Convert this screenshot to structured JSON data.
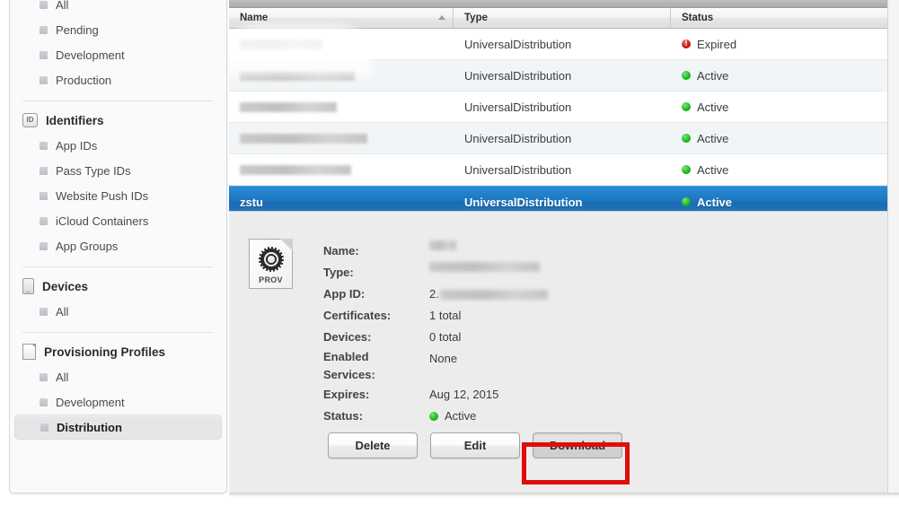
{
  "sidebar": {
    "groups": [
      {
        "name": "certificates-group",
        "header": null,
        "icon": null,
        "items": [
          {
            "label": "All",
            "selected": false
          },
          {
            "label": "Pending",
            "selected": false
          },
          {
            "label": "Development",
            "selected": false
          },
          {
            "label": "Production",
            "selected": false
          }
        ]
      },
      {
        "name": "identifiers-group",
        "header": "Identifiers",
        "icon": "id-badge-icon",
        "icon_text": "ID",
        "items": [
          {
            "label": "App IDs",
            "selected": false
          },
          {
            "label": "Pass Type IDs",
            "selected": false
          },
          {
            "label": "Website Push IDs",
            "selected": false
          },
          {
            "label": "iCloud Containers",
            "selected": false
          },
          {
            "label": "App Groups",
            "selected": false
          }
        ]
      },
      {
        "name": "devices-group",
        "header": "Devices",
        "icon": "device-phone-icon",
        "items": [
          {
            "label": "All",
            "selected": false
          }
        ]
      },
      {
        "name": "provisioning-profiles-group",
        "header": "Provisioning Profiles",
        "icon": "document-icon",
        "items": [
          {
            "label": "All",
            "selected": false
          },
          {
            "label": "Development",
            "selected": false
          },
          {
            "label": "Distribution",
            "selected": true
          }
        ]
      }
    ]
  },
  "table": {
    "columns": [
      {
        "label": "Name",
        "sorted": "ascending",
        "sort_icon": "sort-ascending-arrow-icon"
      },
      {
        "label": "Type",
        "sorted": null
      },
      {
        "label": "Status",
        "sorted": null
      }
    ],
    "rows": [
      {
        "name": "",
        "redacted": true,
        "redact_width": 92,
        "type": "UniversalDistribution",
        "status": "Expired",
        "status_icon": "error-circle-icon",
        "selected": false
      },
      {
        "name": "",
        "redacted": true,
        "redact_width": 128,
        "type": "UniversalDistribution",
        "status": "Active",
        "status_icon": "active-dot-icon",
        "selected": false
      },
      {
        "name": "",
        "redacted": true,
        "redact_width": 108,
        "type": "UniversalDistribution",
        "status": "Active",
        "status_icon": "active-dot-icon",
        "selected": false
      },
      {
        "name": "",
        "redacted": true,
        "redact_width": 142,
        "type": "UniversalDistribution",
        "status": "Active",
        "status_icon": "active-dot-icon",
        "selected": false
      },
      {
        "name": "",
        "redacted": true,
        "redact_width": 124,
        "type": "UniversalDistribution",
        "status": "Active",
        "status_icon": "active-dot-icon",
        "selected": false
      },
      {
        "name": "zstu",
        "redacted": false,
        "redact_width": 0,
        "type": "UniversalDistribution",
        "status": "Active",
        "status_icon": "active-dot-icon",
        "selected": true
      }
    ]
  },
  "detail": {
    "icon": "provisioning-profile-file-icon",
    "icon_label": "PROV",
    "fields": [
      {
        "label": "Name:",
        "value": "",
        "redacted": true,
        "redact_width": 30
      },
      {
        "label": "Type:",
        "value": "",
        "redacted": true,
        "redact_width": 123
      },
      {
        "label": "App ID:",
        "value": "",
        "redacted": true,
        "redact_width": 120,
        "prefix": "2."
      },
      {
        "label": "Certificates:",
        "value": "1 total",
        "redacted": false,
        "redact_width": 0
      },
      {
        "label": "Devices:",
        "value": "0 total",
        "redacted": false,
        "redact_width": 0
      },
      {
        "label": "Enabled Services:",
        "value": "None",
        "redacted": false,
        "redact_width": 0,
        "two_line": true
      },
      {
        "label": "Expires:",
        "value": "Aug 12, 2015",
        "redacted": false,
        "redact_width": 0
      },
      {
        "label": "Status:",
        "value": "Active",
        "redacted": false,
        "redact_width": 0,
        "status_icon": "active-dot-icon"
      }
    ],
    "buttons": [
      {
        "label": "Delete",
        "name": "delete-button",
        "pressed": false,
        "highlighted": false
      },
      {
        "label": "Edit",
        "name": "edit-button",
        "pressed": false,
        "highlighted": false
      },
      {
        "label": "Download",
        "name": "download-button",
        "pressed": true,
        "highlighted": true
      }
    ],
    "highlight_color": "#dd0e0e"
  },
  "colors": {
    "selection_blue": "#1a74be",
    "active_green": "#18b818",
    "expired_red": "#cc1212",
    "annotation_red": "#dd0e0e",
    "sidebar_bg": "#fafafa",
    "detail_bg": "#ececec"
  }
}
